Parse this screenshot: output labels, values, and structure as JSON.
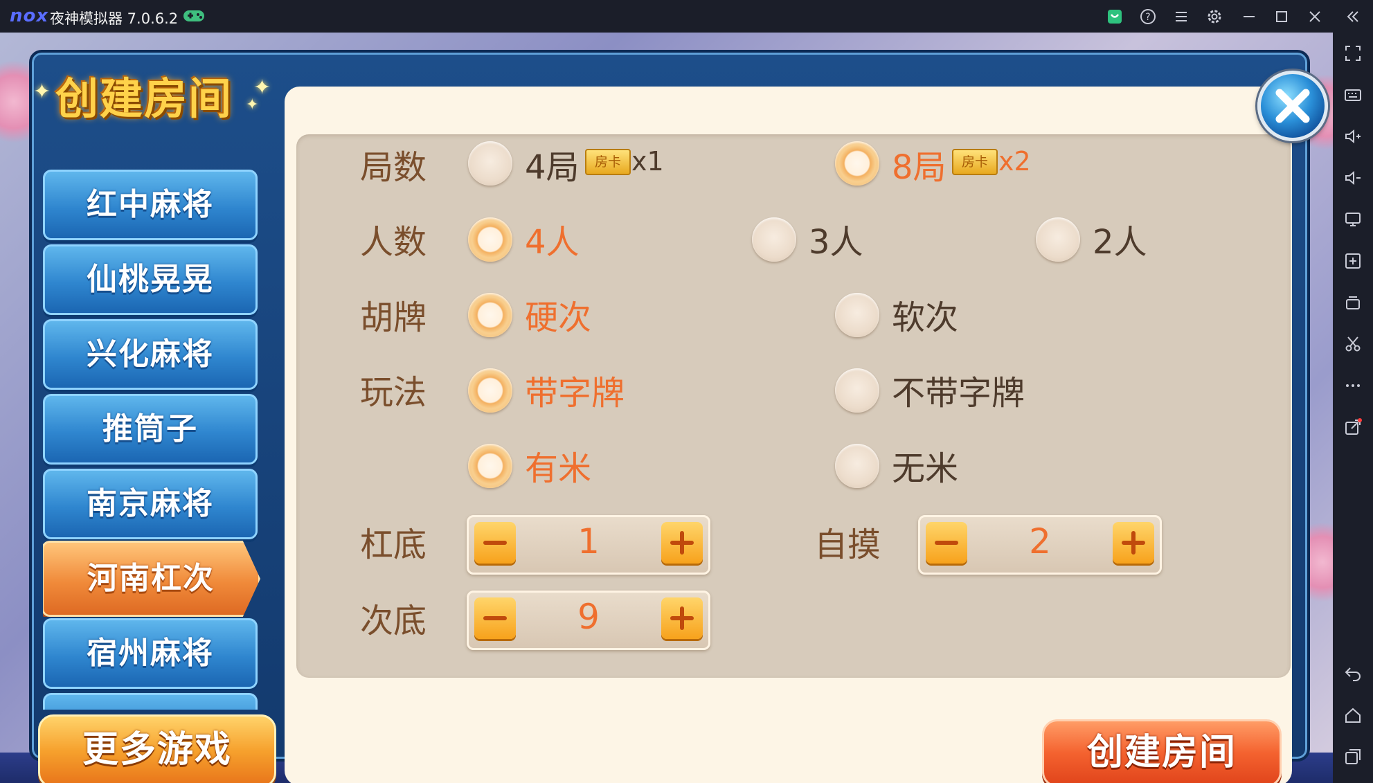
{
  "titlebar": {
    "logo": "nox",
    "title": "夜神模拟器 7.0.6.2",
    "icons": [
      "gamepad-icon",
      "store-icon",
      "help-icon",
      "menu-icon",
      "settings-icon",
      "minimize-icon",
      "maximize-icon",
      "close-window-icon",
      "collapse-sidebar-icon"
    ]
  },
  "sidebar": {
    "icons": [
      "fullscreen-icon",
      "keyboard-icon",
      "volume-up-icon",
      "volume-down-icon",
      "screen-icon",
      "add-apk-icon",
      "multi-instance-icon",
      "screenshot-icon",
      "more-icon",
      "share-icon",
      "back-icon",
      "home-icon",
      "recent-apps-icon"
    ]
  },
  "dialog": {
    "title": "创建房间",
    "close_label": "close"
  },
  "games": [
    {
      "label": "红中麻将",
      "active": false
    },
    {
      "label": "仙桃晃晃",
      "active": false
    },
    {
      "label": "兴化麻将",
      "active": false
    },
    {
      "label": "推筒子",
      "active": false
    },
    {
      "label": "南京麻将",
      "active": false
    },
    {
      "label": "河南杠次",
      "active": true
    },
    {
      "label": "宿州麻将",
      "active": false
    }
  ],
  "more_games": "更多游戏",
  "create_room": "创建房间",
  "options": {
    "rounds": {
      "label": "局数",
      "choices": [
        {
          "label": "4局",
          "card": "房卡",
          "mult": "x1",
          "selected": false
        },
        {
          "label": "8局",
          "card": "房卡",
          "mult": "x2",
          "selected": true
        }
      ]
    },
    "players": {
      "label": "人数",
      "choices": [
        {
          "label": "4人",
          "selected": true
        },
        {
          "label": "3人",
          "selected": false
        },
        {
          "label": "2人",
          "selected": false
        }
      ]
    },
    "hupai": {
      "label": "胡牌",
      "choices": [
        {
          "label": "硬次",
          "selected": true
        },
        {
          "label": "软次",
          "selected": false
        }
      ]
    },
    "playstyle": {
      "label": "玩法",
      "choices": [
        {
          "label": "带字牌",
          "selected": true
        },
        {
          "label": "不带字牌",
          "selected": false
        }
      ]
    },
    "mi": {
      "choices": [
        {
          "label": "有米",
          "selected": true
        },
        {
          "label": "无米",
          "selected": false
        }
      ]
    },
    "gangdi": {
      "label": "杠底",
      "value": "1"
    },
    "zimo": {
      "label": "自摸",
      "value": "2"
    },
    "cidi": {
      "label": "次底",
      "value": "9"
    }
  },
  "colors": {
    "accent": "#ef6f2e",
    "label": "#7a4e2c",
    "panel": "#d7cbbb",
    "content_bg": "#fdf5e6"
  }
}
